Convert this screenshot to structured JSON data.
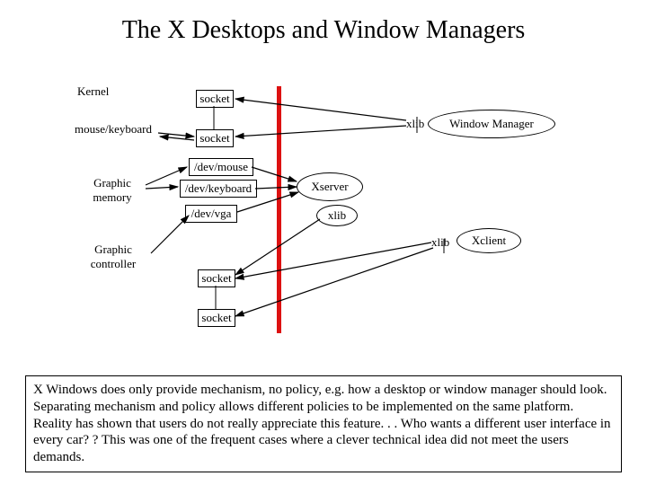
{
  "title": "The X Desktops and Window Managers",
  "labels": {
    "kernel": "Kernel",
    "mouse_keyboard": "mouse/keyboard",
    "graphic_memory": "Graphic\nmemory",
    "graphic_controller": "Graphic\ncontroller",
    "xlib1": "xlib",
    "xlib2": "xlib",
    "socket1": "socket",
    "socket2": "socket",
    "dev_mouse": "/dev/mouse",
    "dev_keyboard": "/dev/keyboard",
    "dev_vga": "/dev/vga",
    "socket3": "socket",
    "socket4": "socket",
    "xserver": "Xserver",
    "window_manager": "Window Manager",
    "xclient": "Xclient"
  },
  "paragraph": "X Windows does only provide mechanism, no policy, e.g. how a desktop or window manager should look. Separating mechanism and policy allows different policies to be implemented on the same platform. Reality has shown that users do not really appreciate this feature. . . Who wants a different user interface in every car? ? This was one of the frequent cases where a clever technical idea did not meet the users demands."
}
